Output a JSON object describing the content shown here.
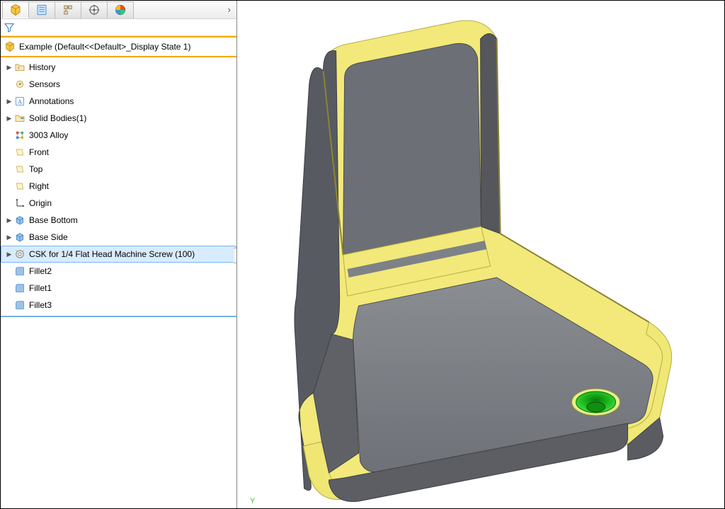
{
  "tabs": [
    {
      "name": "feature-manager",
      "active": true
    },
    {
      "name": "property-manager",
      "active": false
    },
    {
      "name": "configuration-manager",
      "active": false
    },
    {
      "name": "dimxpert-manager",
      "active": false
    },
    {
      "name": "display-manager",
      "active": false
    }
  ],
  "root_label": "Example  (Default<<Default>_Display State 1)",
  "tree": [
    {
      "exp": true,
      "icon": "folder",
      "label": "History"
    },
    {
      "exp": false,
      "icon": "sensor",
      "label": "Sensors"
    },
    {
      "exp": true,
      "icon": "annotation",
      "label": "Annotations"
    },
    {
      "exp": true,
      "icon": "solidbody",
      "label": "Solid Bodies(1)"
    },
    {
      "exp": false,
      "icon": "material",
      "label": "3003 Alloy"
    },
    {
      "exp": false,
      "icon": "plane",
      "label": "Front"
    },
    {
      "exp": false,
      "icon": "plane",
      "label": "Top"
    },
    {
      "exp": false,
      "icon": "plane",
      "label": "Right"
    },
    {
      "exp": false,
      "icon": "origin",
      "label": "Origin"
    },
    {
      "exp": true,
      "icon": "feature",
      "label": "Base Bottom"
    },
    {
      "exp": true,
      "icon": "feature",
      "label": "Base Side"
    },
    {
      "exp": true,
      "icon": "hole",
      "label": "CSK for 1/4 Flat Head Machine Screw (100)",
      "selected": true
    },
    {
      "exp": false,
      "icon": "fillet",
      "label": "Fillet2"
    },
    {
      "exp": false,
      "icon": "fillet",
      "label": "Fillet1"
    },
    {
      "exp": false,
      "icon": "fillet",
      "label": "Fillet3"
    }
  ],
  "axis_label": "Y"
}
